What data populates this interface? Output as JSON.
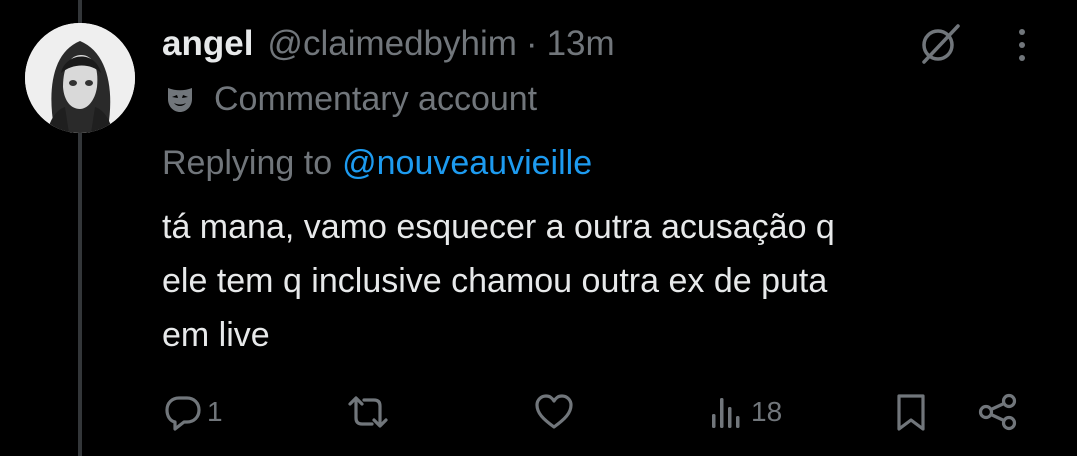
{
  "tweet": {
    "author": {
      "display_name": "angel",
      "handle": "@claimedbyhim",
      "separator": "·",
      "time": "13m",
      "label": "Commentary account",
      "label_icon": "mask-icon"
    },
    "replying": {
      "prefix": "Replying to",
      "mention": "@nouveauvieille"
    },
    "text_lines": [
      "tá mana, vamo esquecer a outra acusação q",
      "ele tem q inclusive chamou outra ex de puta",
      "em live"
    ],
    "actions": {
      "reply_count": "1",
      "retweet_count": "",
      "like_count": "",
      "views_count": "18"
    },
    "icons": [
      "grok-icon",
      "more-icon",
      "reply-icon",
      "retweet-icon",
      "like-icon",
      "views-icon",
      "bookmark-icon",
      "share-icon"
    ]
  },
  "colors": {
    "background": "#000000",
    "text": "#e7e9ea",
    "muted": "#71767b",
    "link": "#1d9bf0",
    "thread_line": "#333639"
  }
}
